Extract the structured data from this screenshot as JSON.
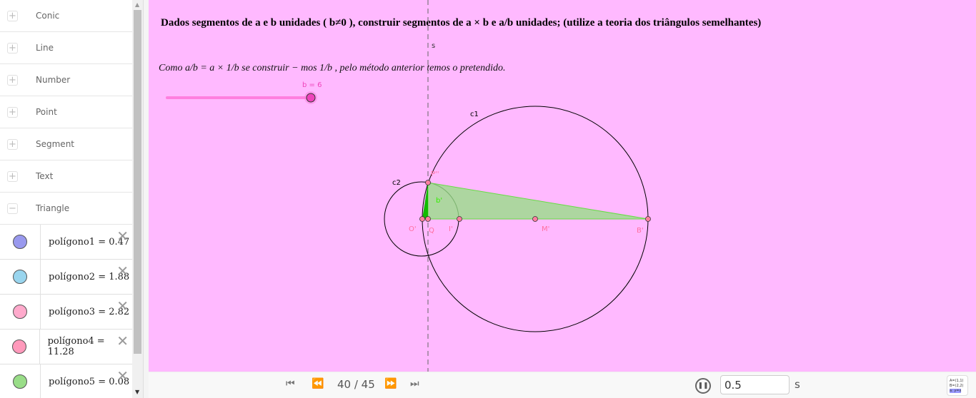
{
  "sidebar": {
    "categories": [
      {
        "label": "Conic"
      },
      {
        "label": "Line"
      },
      {
        "label": "Number"
      },
      {
        "label": "Point"
      },
      {
        "label": "Segment"
      },
      {
        "label": "Text"
      },
      {
        "label": "Triangle",
        "expanded": true
      }
    ],
    "items": [
      {
        "label": "polígono1 = 0.47",
        "color": "#9999ee"
      },
      {
        "label": "polígono2 = 1.88",
        "color": "#99d5ee"
      },
      {
        "label": "polígono3 = 2.82",
        "color": "#ffaacc"
      },
      {
        "label": "polígono4 = 11.28",
        "color": "#ff99bb"
      },
      {
        "label": "polígono5 = 0.08",
        "color": "#99dd88"
      }
    ]
  },
  "canvas": {
    "title": "Dados segmentos de a e b unidades ( b≠0 ), construir segmentos de a × b e a/b unidades; (utilize a teoria dos triângulos semelhantes)",
    "note": "Como a/b = a × 1/b se construir − mos 1/b , pelo método anterior temos o pretendido.",
    "slider": {
      "label": "b = 6",
      "value": 6
    },
    "labels": {
      "s": "s",
      "c1": "c1",
      "c2": "c2",
      "P": "P''",
      "b": "b'",
      "O": "O'",
      "Q": "Q",
      "I": "I'",
      "M": "M'",
      "B": "B'"
    },
    "background": "#ffb9ff"
  },
  "bottom": {
    "step": "40 / 45",
    "speed": "0.5",
    "unit": "s"
  }
}
